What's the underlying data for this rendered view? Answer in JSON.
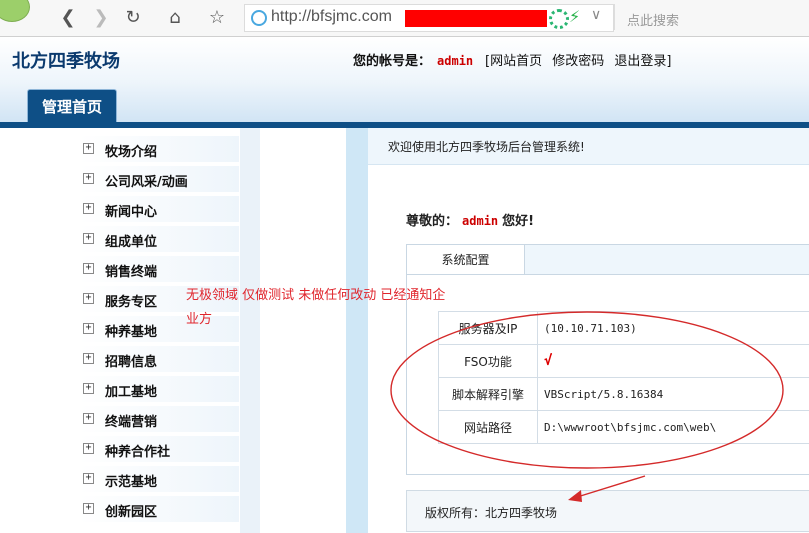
{
  "browser": {
    "url": "http://bfsjmc.com",
    "search_placeholder": "点此搜索"
  },
  "header": {
    "site_name": "北方四季牧场",
    "account_label": "您的帐号是：",
    "username": "admin",
    "links": [
      "[网站首页",
      "修改密码",
      "退出登录]"
    ],
    "tab": "管理首页"
  },
  "sidebar": {
    "items": [
      "牧场介绍",
      "公司风采/动画",
      "新闻中心",
      "组成单位",
      "销售终端",
      "服务专区",
      "种养基地",
      "招聘信息",
      "加工基地",
      "终端营销",
      "种养合作社",
      "示范基地",
      "创新园区"
    ]
  },
  "main": {
    "welcome": "欢迎使用北方四季牧场后台管理系统!",
    "greet_prefix": "尊敬的：",
    "greet_user": "admin",
    "greet_suffix": "您好!",
    "panel_tab": "系统配置",
    "config": [
      {
        "key": "服务器及IP",
        "value": "(10.10.71.103)"
      },
      {
        "key": "FSO功能",
        "value": "√"
      },
      {
        "key": "脚本解释引擎",
        "value": "VBScript/5.8.16384"
      },
      {
        "key": "网站路径",
        "value": "D:\\wwwroot\\bfsjmc.com\\web\\"
      }
    ],
    "copyright": "版权所有：北方四季牧场"
  },
  "annotation": {
    "note": "无极领域 仅做测试 未做任何改动 已经通知企业方",
    "color": "#e0262d"
  }
}
